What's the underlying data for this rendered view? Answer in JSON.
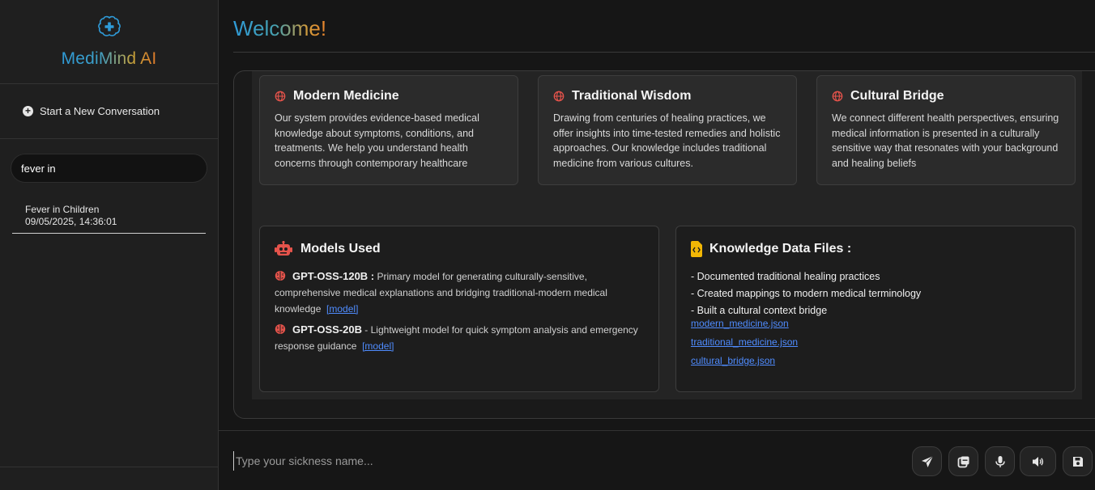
{
  "brand": {
    "name": "MediMind AI",
    "icon": "brain-plus-icon"
  },
  "sidebar": {
    "new_conversation": "Start a New Conversation",
    "search_value": "fever in",
    "conversations": [
      {
        "title": "Fever in Children",
        "timestamp": "09/05/2025, 14:36:01"
      }
    ]
  },
  "main": {
    "welcome": "Welcome!",
    "cards": [
      {
        "title": "Modern Medicine",
        "icon": "globe-icon",
        "text": "Our system provides evidence-based medical knowledge about symptoms, conditions, and treatments. We help you understand health concerns through contemporary healthcare"
      },
      {
        "title": "Traditional Wisdom",
        "icon": "globe-icon",
        "text": "Drawing from centuries of healing practices, we offer insights into time-tested remedies and holistic approaches. Our knowledge includes traditional medicine from various cultures."
      },
      {
        "title": "Cultural Bridge",
        "icon": "globe-icon",
        "text": "We connect different health perspectives, ensuring medical information is presented in a culturally sensitive way that resonates with your background and healing beliefs"
      }
    ],
    "models": {
      "title": "Models Used",
      "icon": "robot-icon",
      "items": [
        {
          "name": "GPT-OSS-120B :",
          "desc": " Primary model for generating culturally-sensitive, comprehensive medical explanations and bridging traditional-modern medical knowledge",
          "link": "[model]"
        },
        {
          "name": "GPT-OSS-20B",
          "desc": " - Lightweight model for quick symptom analysis and emergency response guidance",
          "link": "[model]"
        }
      ]
    },
    "knowledge": {
      "title": "Knowledge Data Files :",
      "icon": "code-file-icon",
      "bullets": [
        "- Documented traditional healing practices",
        "- Created mappings to modern medical terminology",
        "- Built a cultural context bridge"
      ],
      "files": [
        "modern_medicine.json",
        "traditional_medicine.json",
        "cultural_bridge.json"
      ]
    }
  },
  "input": {
    "placeholder": "Type your sickness name...",
    "buttons": [
      "send-icon",
      "copy-icon",
      "microphone-icon",
      "speaker-icon",
      "save-icon"
    ]
  },
  "colors": {
    "accent_red": "#e5534b",
    "link": "#4f8cff",
    "brand_blue": "#2f9bd8",
    "brand_orange": "#e07b2a"
  }
}
